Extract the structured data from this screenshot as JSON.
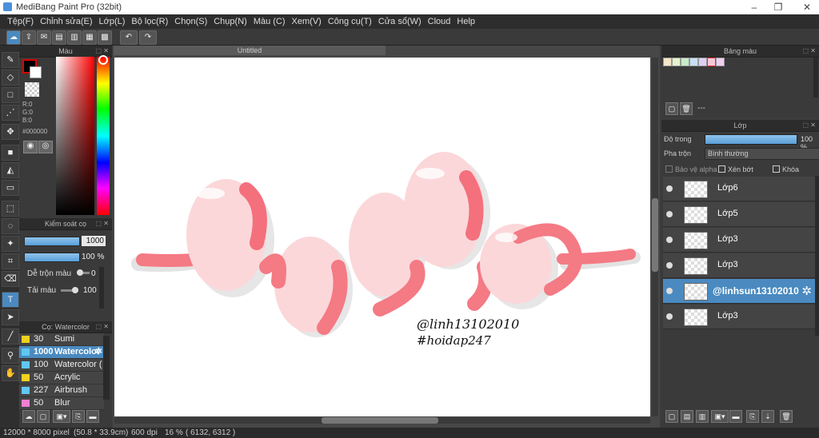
{
  "window": {
    "title": "MediBang Paint Pro (32bit)"
  },
  "menu": [
    "Tệp(F)",
    "Chỉnh sửa(E)",
    "Lớp(L)",
    "Bộ lọc(R)",
    "Chọn(S)",
    "Chụp(N)",
    "Màu (C)",
    "Xem(V)",
    "Công cụ(T)",
    "Cửa sổ(W)",
    "Cloud",
    "Help"
  ],
  "color_panel": {
    "title": "Màu",
    "r": "R:0",
    "g": "G:0",
    "b": "B:0",
    "hex": "#000000",
    "primary": "#000000",
    "secondary": "#ffffff"
  },
  "brush_control": {
    "title": "Kiểm soát cọ",
    "size": "1000",
    "opacity": "100 %",
    "blend_label": "Dễ trộn màu",
    "blend_value": "0",
    "load_label": "Tải màu",
    "load_value": "100"
  },
  "brush_list": {
    "title": "Cọ: Watercolor",
    "items": [
      {
        "size": "30",
        "name": "Sumi",
        "color": "#f0d020"
      },
      {
        "size": "1000",
        "name": "Watercolor",
        "color": "#60c8f0",
        "selected": true
      },
      {
        "size": "100",
        "name": "Watercolor (",
        "color": "#60c8f0"
      },
      {
        "size": "50",
        "name": "Acrylic",
        "color": "#f0d020"
      },
      {
        "size": "227",
        "name": "Airbrush",
        "color": "#60c8f0"
      },
      {
        "size": "50",
        "name": "Blur",
        "color": "#f080d0"
      }
    ]
  },
  "document": {
    "tab": "Untitled"
  },
  "canvas_text": {
    "line1": "@linh13102010",
    "line2": "#hoidap247"
  },
  "palette_panel": {
    "title": "Bảng màu",
    "swatches": [
      "#f4e6c8",
      "#e6f4c8",
      "#c8ecc8",
      "#c8e0f4",
      "#dcd0f4",
      "#f4c8d8",
      "#f0d0f0"
    ],
    "footer": "---"
  },
  "layer_panel": {
    "title": "Lớp",
    "opacity_label": "Độ trong",
    "opacity_value": "100 %",
    "opacity_level": 1.0,
    "blend_label": "Pha trộn",
    "blend_value": "Bình thường",
    "protect_alpha": "Bảo vệ alpha",
    "clipping": "Xén bớt",
    "lock": "Khóa",
    "layers": [
      {
        "name": "Lớp6",
        "selected": false
      },
      {
        "name": "Lớp5",
        "selected": false
      },
      {
        "name": "Lớp3",
        "selected": false
      },
      {
        "name": "Lớp3",
        "selected": false
      },
      {
        "name": "@linhsun13102010",
        "selected": true
      },
      {
        "name": "Lớp3",
        "selected": false
      }
    ]
  },
  "status": {
    "size": "12000 * 8000 pixel",
    "physical": "(50.8 * 33.9cm)",
    "dpi": "600 dpi",
    "zoom": "16 %",
    "coords": "( 6132, 6312 )"
  }
}
